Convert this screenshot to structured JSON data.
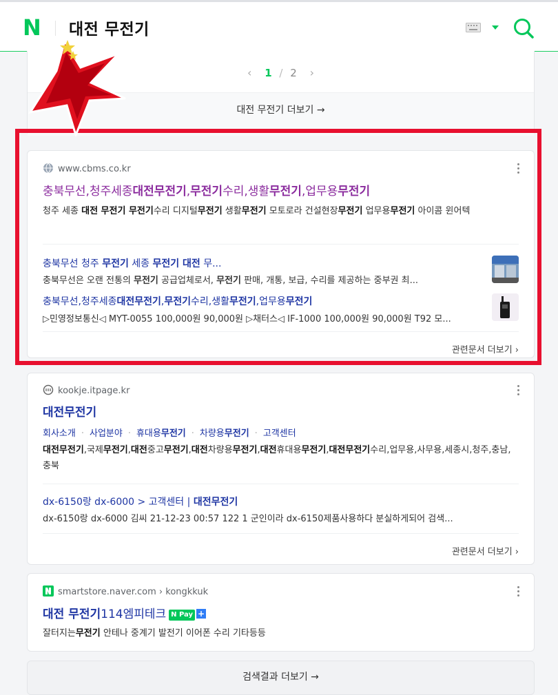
{
  "header": {
    "logo": "N",
    "query": "대전 무전기"
  },
  "pager": {
    "current": "1",
    "separator": "/",
    "total": "2",
    "more": "대전 무전기 더보기 →"
  },
  "result1": {
    "site": "www.cbms.co.kr",
    "title_parts": [
      "충북무선,청주세종",
      "대전무전기",
      ",",
      "무전기",
      "수리,생활",
      "무전기",
      ",업무용",
      "무전기"
    ],
    "desc_parts": [
      "청주 세종 ",
      "대전 무전기 무전기",
      "수리 디지털",
      "무전기",
      " 생활",
      "무전기",
      " 모토로라 건설현장",
      "무전기",
      " 업무용",
      "무전기",
      " 아이콤 윈어텍"
    ],
    "subs": [
      {
        "title_parts": [
          "충북무선 청주 ",
          "무전기",
          " 세종 ",
          "무전기 대전",
          " 무..."
        ],
        "desc_parts": [
          "충북무선은 오랜 전통의 ",
          "무전기",
          " 공급업체로서, ",
          "무전기",
          " 판매, 개통, 보급, 수리를 제공하는 중부권 최..."
        ]
      },
      {
        "title_parts": [
          "충북무선,청주세종",
          "대전무전기",
          ",",
          "무전기",
          "수리,생활",
          "무전기",
          ",업무용",
          "무전기"
        ],
        "desc": "▷민영정보통신◁ MYT-0055 100,000원 90,000원 ▷채터스◁ IF-1000 100,000원 90,000원 T92 모..."
      }
    ],
    "more": "관련문서 더보기 ›"
  },
  "result2": {
    "site": "kookje.itpage.kr",
    "title": "대전무전기",
    "chips": [
      "회사소개",
      "사업분야",
      "휴대용",
      "무전기",
      "차량용",
      "무전기",
      "고객센터"
    ],
    "desc_parts": [
      "대전무전기",
      ",국제",
      "무전기",
      ",",
      "대전",
      "중고",
      "무전기",
      ",",
      "대전",
      "차량용",
      "무전기",
      ",",
      "대전",
      "휴대용",
      "무전기",
      ",",
      "대전무전기",
      "수리,업무용,사무용,세종시,청주,충남,충북"
    ],
    "sub_title_parts": [
      "dx-6150랑 dx-6000 > 고객센터 | ",
      "대전무전기"
    ],
    "sub_desc": "dx-6150랑 dx-6000 김씨 21-12-23 00:57 122 1 군인이라 dx-6150제품사용하다 분실하게되어 검색...",
    "more": "관련문서 더보기 ›"
  },
  "result3": {
    "site": "smartstore.naver.com › kongkkuk",
    "title_parts": [
      "대전 무전기",
      "114엠피테크"
    ],
    "npay": "N Pay",
    "npay_plus": "+",
    "desc_parts": [
      "잘터지는",
      "무전기",
      " 안테나 중계기 발전기 이어폰 수리 기타등등"
    ]
  },
  "bottom": {
    "more": "검색결과 더보기 →"
  },
  "colors": {
    "brand": "#03c75a",
    "link": "#1e35a3",
    "visited": "#8b2c9e",
    "highlight_box": "#e8102f"
  }
}
